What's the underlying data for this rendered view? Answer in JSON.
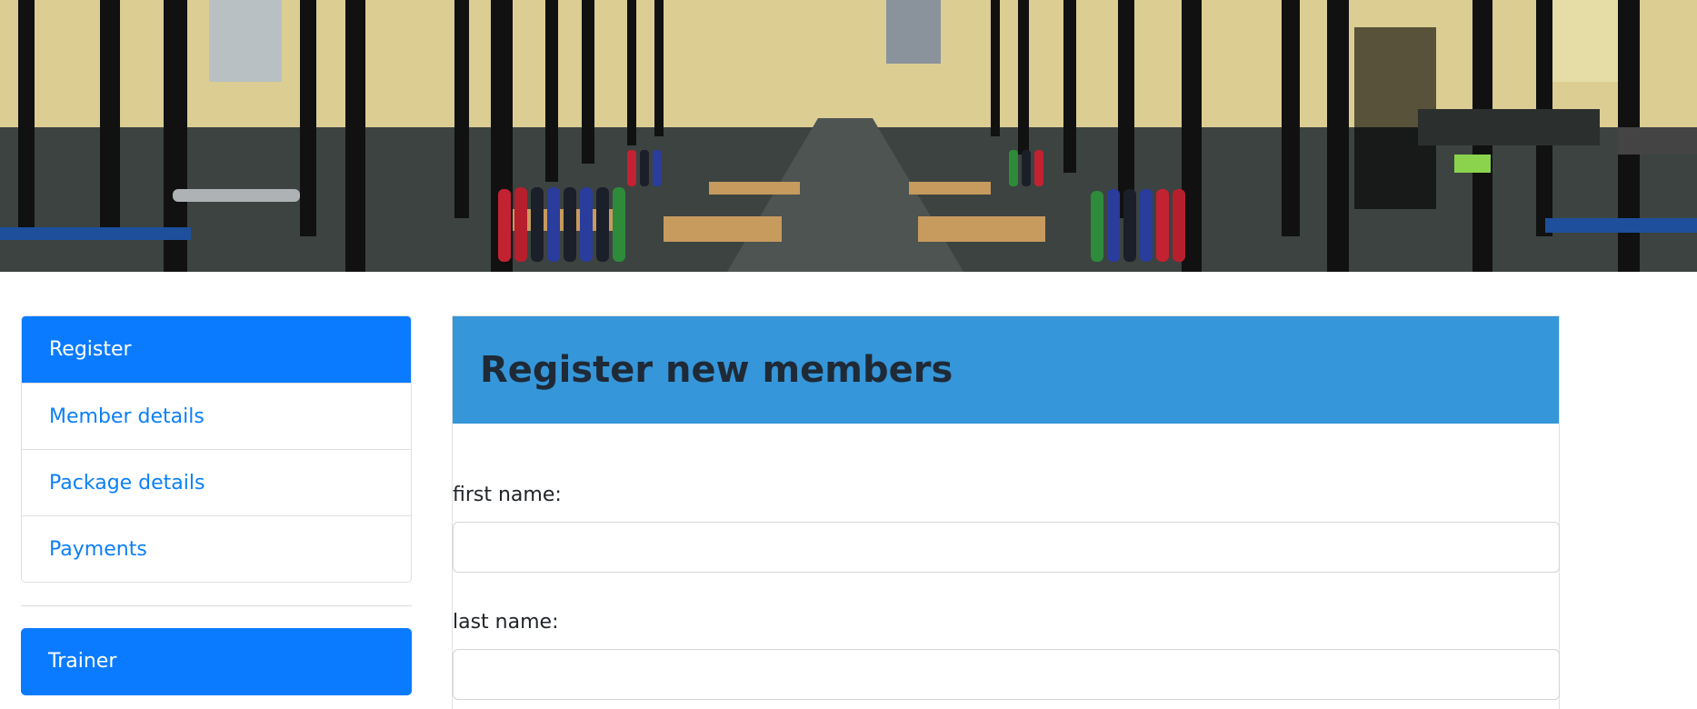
{
  "banner": {
    "alt": "gym weight room"
  },
  "sidebar": {
    "items": [
      {
        "label": "Register",
        "active": true
      },
      {
        "label": "Member details",
        "active": false
      },
      {
        "label": "Package details",
        "active": false
      },
      {
        "label": "Payments",
        "active": false
      }
    ],
    "trainer_label": "Trainer"
  },
  "main": {
    "title": "Register new members",
    "fields": [
      {
        "label": "first name:",
        "value": ""
      },
      {
        "label": "last name:",
        "value": ""
      }
    ]
  },
  "colors": {
    "primary": "#0a7bff",
    "header": "#3596d9",
    "link": "#0d7ff7"
  }
}
